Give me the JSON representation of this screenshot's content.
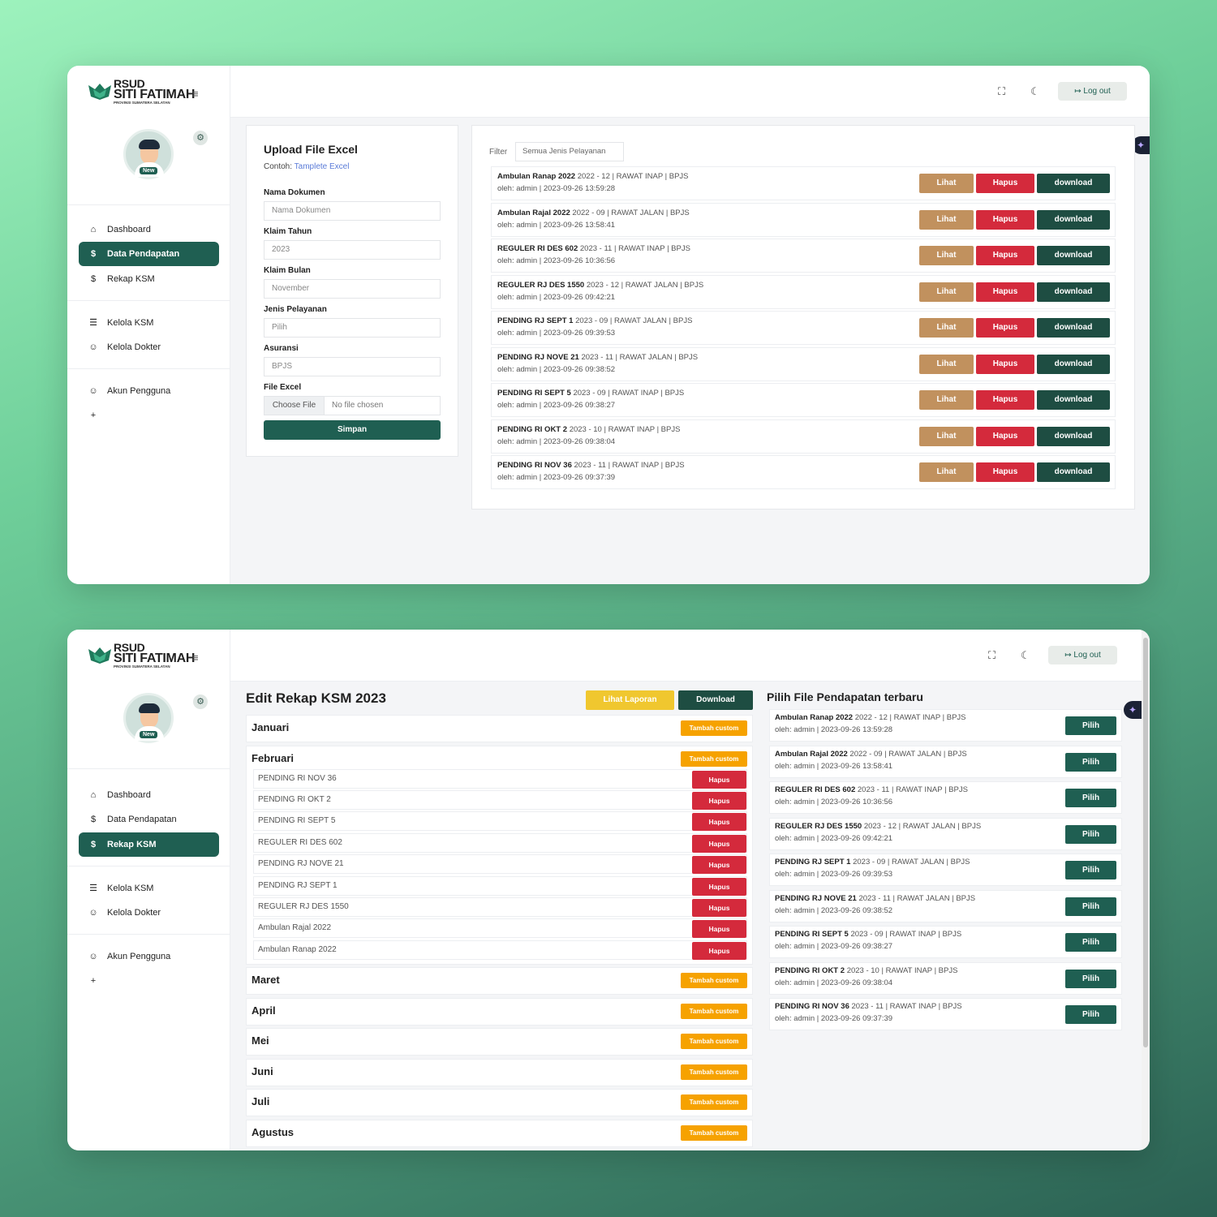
{
  "logo": {
    "line1": "RSUD",
    "line2": "SITI FATIMAH",
    "line3": "PROVINSI SUMATERA SELATAN"
  },
  "avatar_badge": "New",
  "nav": {
    "dashboard": "Dashboard",
    "data_pendapatan": "Data Pendapatan",
    "rekap_ksm": "Rekap KSM",
    "kelola_ksm": "Kelola KSM",
    "kelola_dokter": "Kelola Dokter",
    "akun_pengguna": "Akun Pengguna"
  },
  "topbar": {
    "logout": "Log out"
  },
  "upload": {
    "title": "Upload File Excel",
    "example_prefix": "Contoh:",
    "example_link": "Tamplete Excel",
    "nama_label": "Nama Dokumen",
    "nama_placeholder": "Nama Dokumen",
    "tahun_label": "Klaim Tahun",
    "tahun_value": "2023",
    "bulan_label": "Klaim Bulan",
    "bulan_value": "November",
    "jenis_label": "Jenis Pelayanan",
    "jenis_value": "Pilih",
    "asuransi_label": "Asuransi",
    "asuransi_value": "BPJS",
    "file_label": "File Excel",
    "choose_file": "Choose File",
    "no_file": "No file chosen",
    "submit": "Simpan"
  },
  "filter": {
    "label": "Filter",
    "value": "Semua Jenis Pelayanan"
  },
  "buttons": {
    "lihat": "Lihat",
    "hapus": "Hapus",
    "download": "download",
    "pilih": "Pilih",
    "tambah_custom": "Tambah custom"
  },
  "files": [
    {
      "name": "Ambulan Ranap 2022",
      "info": "2022 - 12 | RAWAT INAP | BPJS",
      "meta": "oleh: admin | 2023-09-26 13:59:28"
    },
    {
      "name": "Ambulan Rajal 2022",
      "info": "2022 - 09 | RAWAT JALAN | BPJS",
      "meta": "oleh: admin | 2023-09-26 13:58:41"
    },
    {
      "name": "REGULER RI DES 602",
      "info": "2023 - 11 | RAWAT INAP | BPJS",
      "meta": "oleh: admin | 2023-09-26 10:36:56"
    },
    {
      "name": "REGULER RJ DES 1550",
      "info": "2023 - 12 | RAWAT JALAN | BPJS",
      "meta": "oleh: admin | 2023-09-26 09:42:21"
    },
    {
      "name": "PENDING RJ SEPT 1",
      "info": "2023 - 09 | RAWAT JALAN | BPJS",
      "meta": "oleh: admin | 2023-09-26 09:39:53"
    },
    {
      "name": "PENDING RJ NOVE 21",
      "info": "2023 - 11 | RAWAT JALAN | BPJS",
      "meta": "oleh: admin | 2023-09-26 09:38:52"
    },
    {
      "name": "PENDING RI SEPT 5",
      "info": "2023 - 09 | RAWAT INAP | BPJS",
      "meta": "oleh: admin | 2023-09-26 09:38:27"
    },
    {
      "name": "PENDING RI OKT 2",
      "info": "2023 - 10 | RAWAT INAP | BPJS",
      "meta": "oleh: admin | 2023-09-26 09:38:04"
    },
    {
      "name": "PENDING RI NOV 36",
      "info": "2023 - 11 | RAWAT INAP | BPJS",
      "meta": "oleh: admin | 2023-09-26 09:37:39"
    }
  ],
  "rekap": {
    "title": "Edit Rekap KSM 2023",
    "lihat_laporan": "Lihat Laporan",
    "download": "Download",
    "months": [
      "Januari",
      "Februari",
      "Maret",
      "April",
      "Mei",
      "Juni",
      "Juli",
      "Agustus"
    ],
    "februari_items": [
      "PENDING RI NOV 36",
      "PENDING RI OKT 2",
      "PENDING RI SEPT 5",
      "REGULER RI DES 602",
      "PENDING RJ NOVE 21",
      "PENDING RJ SEPT 1",
      "REGULER RJ DES 1550",
      "Ambulan Rajal 2022",
      "Ambulan Ranap 2022"
    ]
  },
  "pilih_title": "Pilih File Pendapatan terbaru"
}
